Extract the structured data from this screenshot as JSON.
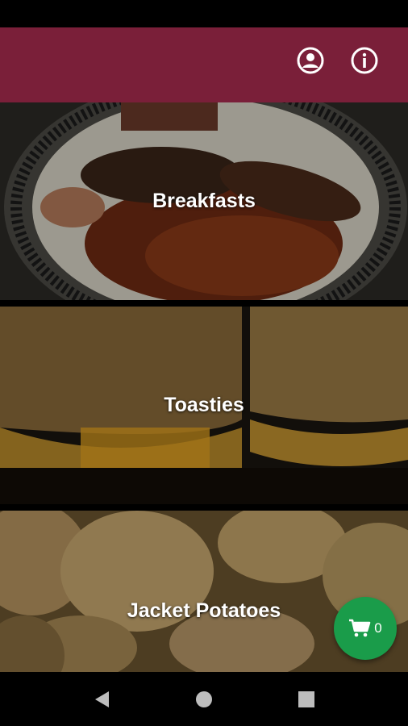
{
  "app_bar": {
    "background": "#7a1f39",
    "actions": [
      {
        "icon": "account-circle-icon"
      },
      {
        "icon": "info-icon"
      }
    ]
  },
  "categories": [
    {
      "label": "Breakfasts",
      "image": "breakfast-photo"
    },
    {
      "label": "Toasties",
      "image": "toastie-photo"
    },
    {
      "label": "Jacket Potatoes",
      "image": "potatoes-photo"
    }
  ],
  "cart": {
    "icon": "cart-icon",
    "count": "0",
    "color": "#1a9c4a"
  },
  "nav": {
    "buttons": [
      "back-icon",
      "home-icon",
      "recent-apps-icon"
    ]
  }
}
